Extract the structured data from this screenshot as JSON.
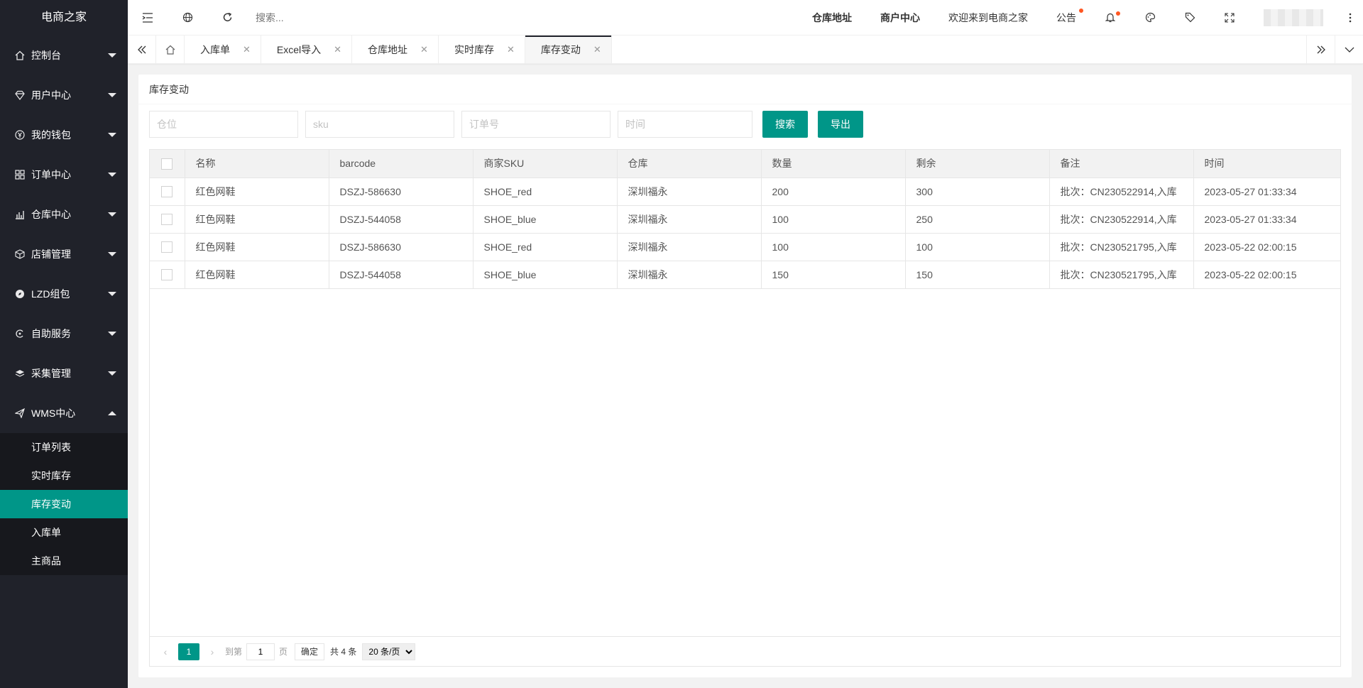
{
  "app": {
    "title": "电商之家"
  },
  "sidebar": {
    "items": [
      {
        "label": "控制台",
        "icon": "home-icon"
      },
      {
        "label": "用户中心",
        "icon": "diamond-icon"
      },
      {
        "label": "我的钱包",
        "icon": "yen-icon"
      },
      {
        "label": "订单中心",
        "icon": "apps-icon"
      },
      {
        "label": "仓库中心",
        "icon": "chart-icon"
      },
      {
        "label": "店铺管理",
        "icon": "box-icon"
      },
      {
        "label": "LZD组包",
        "icon": "compass-icon"
      },
      {
        "label": "自助服务",
        "icon": "service-icon"
      },
      {
        "label": "采集管理",
        "icon": "layers-icon"
      },
      {
        "label": "WMS中心",
        "icon": "send-icon"
      }
    ],
    "submenu": [
      "订单列表",
      "实时库存",
      "库存变动",
      "入库单",
      "主商品"
    ],
    "active_sub": "库存变动"
  },
  "header": {
    "search_placeholder": "搜索...",
    "links": {
      "warehouse": "仓库地址",
      "merchant": "商户中心",
      "welcome": "欢迎来到电商之家",
      "notice": "公告"
    }
  },
  "tabs": [
    "入库单",
    "Excel导入",
    "仓库地址",
    "实时库存",
    "库存变动"
  ],
  "card": {
    "title": "库存变动"
  },
  "filters": {
    "location_placeholder": "仓位",
    "sku_placeholder": "sku",
    "order_placeholder": "订单号",
    "time_placeholder": "时间",
    "search_button": "搜索",
    "export_button": "导出"
  },
  "table": {
    "headers": [
      "名称",
      "barcode",
      "商家SKU",
      "仓库",
      "数量",
      "剩余",
      "备注",
      "时间"
    ],
    "rows": [
      [
        "红色网鞋",
        "DSZJ-586630",
        "SHOE_red",
        "深圳福永",
        "200",
        "300",
        "批次：CN230522914,入库",
        "2023-05-27 01:33:34"
      ],
      [
        "红色网鞋",
        "DSZJ-544058",
        "SHOE_blue",
        "深圳福永",
        "100",
        "250",
        "批次：CN230522914,入库",
        "2023-05-27 01:33:34"
      ],
      [
        "红色网鞋",
        "DSZJ-586630",
        "SHOE_red",
        "深圳福永",
        "100",
        "100",
        "批次：CN230521795,入库",
        "2023-05-22 02:00:15"
      ],
      [
        "红色网鞋",
        "DSZJ-544058",
        "SHOE_blue",
        "深圳福永",
        "150",
        "150",
        "批次：CN230521795,入库",
        "2023-05-22 02:00:15"
      ]
    ]
  },
  "pager": {
    "current": "1",
    "goto_label": "到第",
    "goto_value": "1",
    "page_unit": "页",
    "confirm": "确定",
    "total": "共 4 条",
    "page_size": "20 条/页"
  },
  "colors": {
    "accent": "#009688",
    "sidebar": "#20222a",
    "dot": "#ff5722"
  }
}
